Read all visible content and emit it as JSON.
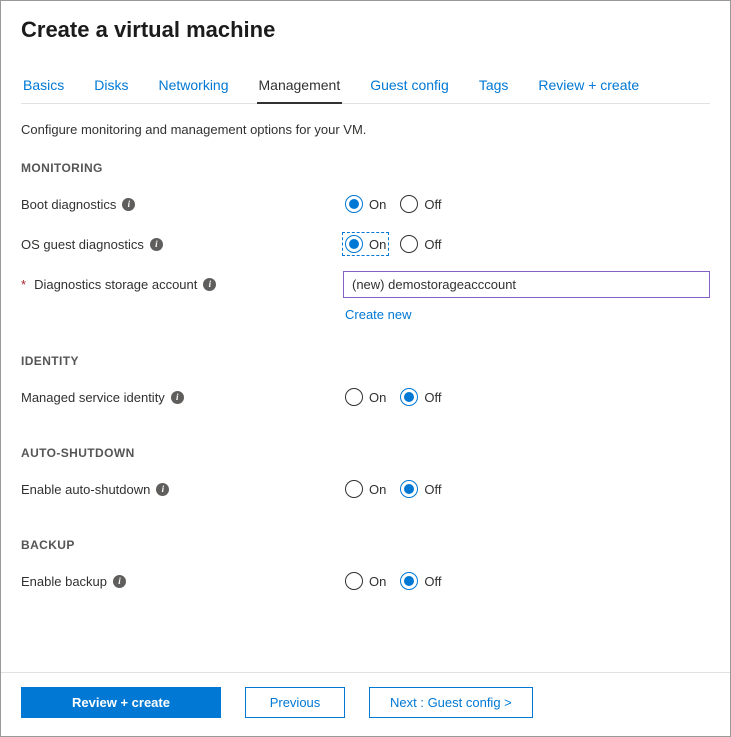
{
  "title": "Create a virtual machine",
  "tabs": [
    "Basics",
    "Disks",
    "Networking",
    "Management",
    "Guest config",
    "Tags",
    "Review + create"
  ],
  "activeTabIndex": 3,
  "intro": "Configure monitoring and management options for your VM.",
  "sections": {
    "monitoring": {
      "heading": "MONITORING",
      "bootDiagnostics": {
        "label": "Boot diagnostics",
        "on": "On",
        "off": "Off",
        "value": "On"
      },
      "osGuestDiagnostics": {
        "label": "OS guest diagnostics",
        "on": "On",
        "off": "Off",
        "value": "On"
      },
      "storageAccount": {
        "label": "Diagnostics storage account",
        "value": "(new) demostorageacccount",
        "createLink": "Create new"
      }
    },
    "identity": {
      "heading": "IDENTITY",
      "managedIdentity": {
        "label": "Managed service identity",
        "on": "On",
        "off": "Off",
        "value": "Off"
      }
    },
    "autoshutdown": {
      "heading": "AUTO-SHUTDOWN",
      "enable": {
        "label": "Enable auto-shutdown",
        "on": "On",
        "off": "Off",
        "value": "Off"
      }
    },
    "backup": {
      "heading": "BACKUP",
      "enable": {
        "label": "Enable backup",
        "on": "On",
        "off": "Off",
        "value": "Off"
      }
    }
  },
  "footer": {
    "reviewCreate": "Review + create",
    "previous": "Previous",
    "next": "Next : Guest config >"
  }
}
